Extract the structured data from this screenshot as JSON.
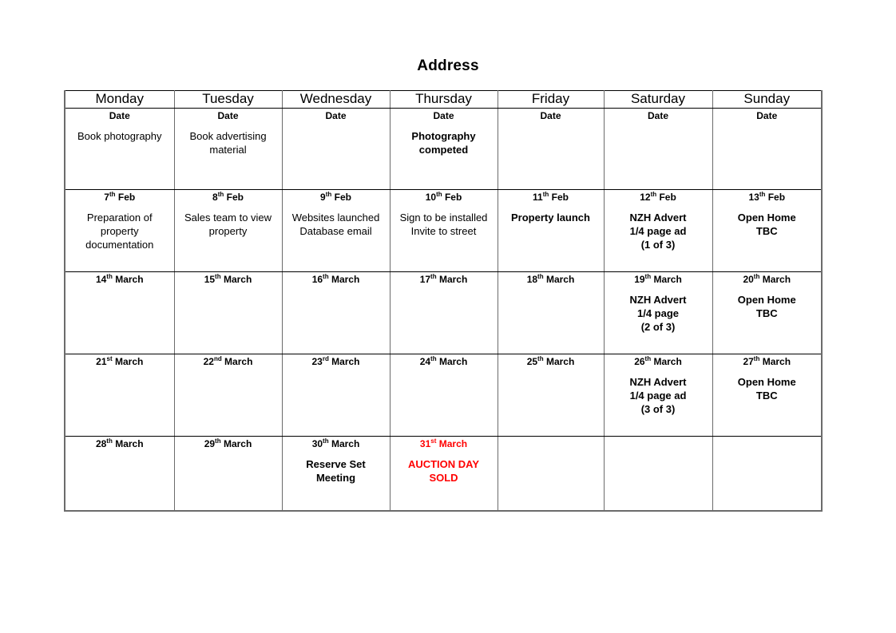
{
  "document": {
    "title": "Address"
  },
  "calendar": {
    "day_headers": [
      "Monday",
      "Tuesday",
      "Wednesday",
      "Thursday",
      "Friday",
      "Saturday",
      "Sunday"
    ],
    "header_date_label": "Date",
    "colors": {
      "text": "#000000",
      "highlight": "#ff0000",
      "border": "#6b6b6b"
    },
    "rows": [
      {
        "row_id": "week-1",
        "cells": [
          {
            "date": "Date",
            "date_ordinal": "",
            "date_suffix": "",
            "body": "Book photography",
            "bold": false,
            "red": false
          },
          {
            "date": "Date",
            "date_ordinal": "",
            "date_suffix": "",
            "body": "Book advertising\nmaterial",
            "bold": false,
            "red": false
          },
          {
            "date": "Date",
            "date_ordinal": "",
            "date_suffix": "",
            "body": "",
            "bold": false,
            "red": false
          },
          {
            "date": "Date",
            "date_ordinal": "",
            "date_suffix": "",
            "body": "Photography\ncompeted",
            "bold": true,
            "red": false
          },
          {
            "date": "Date",
            "date_ordinal": "",
            "date_suffix": "",
            "body": "",
            "bold": false,
            "red": false
          },
          {
            "date": "Date",
            "date_ordinal": "",
            "date_suffix": "",
            "body": "",
            "bold": false,
            "red": false
          },
          {
            "date": "Date",
            "date_ordinal": "",
            "date_suffix": "",
            "body": "",
            "bold": false,
            "red": false
          }
        ]
      },
      {
        "row_id": "week-2",
        "cells": [
          {
            "date_num": "7",
            "date_suffix": "th",
            "date_month": " Feb",
            "body": "Preparation of\nproperty\ndocumentation",
            "bold": false,
            "red": false
          },
          {
            "date_num": "8",
            "date_suffix": "th",
            "date_month": " Feb",
            "body": "Sales team to view\nproperty",
            "bold": false,
            "red": false
          },
          {
            "date_num": "9",
            "date_suffix": "th",
            "date_month": " Feb",
            "body": "Websites launched\nDatabase email",
            "bold": false,
            "red": false
          },
          {
            "date_num": "10",
            "date_suffix": "th",
            "date_month": " Feb",
            "body": "Sign to be installed\nInvite to street",
            "bold": false,
            "red": false
          },
          {
            "date_num": "11",
            "date_suffix": "th",
            "date_month": " Feb",
            "body": "Property launch",
            "bold": true,
            "red": false
          },
          {
            "date_num": "12",
            "date_suffix": "th",
            "date_month": " Feb",
            "body": "NZH Advert\n1/4 page ad\n(1 of 3)",
            "bold": true,
            "red": false
          },
          {
            "date_num": "13",
            "date_suffix": "th",
            "date_month": " Feb",
            "body": "Open Home\nTBC",
            "bold": true,
            "red": false
          }
        ]
      },
      {
        "row_id": "week-3",
        "cells": [
          {
            "date_num": "14",
            "date_suffix": "th",
            "date_month": " March",
            "body": "",
            "bold": false,
            "red": false
          },
          {
            "date_num": "15",
            "date_suffix": "th",
            "date_month": " March",
            "body": "",
            "bold": false,
            "red": false
          },
          {
            "date_num": "16",
            "date_suffix": "th",
            "date_month": " March",
            "body": "",
            "bold": false,
            "red": false
          },
          {
            "date_num": "17",
            "date_suffix": "th",
            "date_month": " March",
            "body": "",
            "bold": false,
            "red": false
          },
          {
            "date_num": "18",
            "date_suffix": "th",
            "date_month": " March",
            "body": "",
            "bold": false,
            "red": false
          },
          {
            "date_num": "19",
            "date_suffix": "th",
            "date_month": " March",
            "body": "NZH Advert\n1/4 page\n(2 of 3)",
            "bold": true,
            "red": false
          },
          {
            "date_num": "20",
            "date_suffix": "th",
            "date_month": " March",
            "body": "Open Home\nTBC",
            "bold": true,
            "red": false
          }
        ]
      },
      {
        "row_id": "week-4",
        "cells": [
          {
            "date_num": "21",
            "date_suffix": "st",
            "date_month": " March",
            "body": "",
            "bold": false,
            "red": false
          },
          {
            "date_num": "22",
            "date_suffix": "nd",
            "date_month": " March",
            "body": "",
            "bold": false,
            "red": false
          },
          {
            "date_num": "23",
            "date_suffix": "rd",
            "date_month": " March",
            "body": "",
            "bold": false,
            "red": false
          },
          {
            "date_num": "24",
            "date_suffix": "th",
            "date_month": " March",
            "body": "",
            "bold": false,
            "red": false
          },
          {
            "date_num": "25",
            "date_suffix": "th",
            "date_month": " March",
            "body": "",
            "bold": false,
            "red": false
          },
          {
            "date_num": "26",
            "date_suffix": "th",
            "date_month": " March",
            "body": "NZH Advert\n1/4 page ad\n(3 of 3)",
            "bold": true,
            "red": false
          },
          {
            "date_num": "27",
            "date_suffix": "th",
            "date_month": " March",
            "body": "Open Home\nTBC",
            "bold": true,
            "red": false
          }
        ]
      },
      {
        "row_id": "week-5",
        "cells": [
          {
            "date_num": "28",
            "date_suffix": "th",
            "date_month": " March",
            "body": "",
            "bold": false,
            "red": false
          },
          {
            "date_num": "29",
            "date_suffix": "th",
            "date_month": " March",
            "body": "",
            "bold": false,
            "red": false
          },
          {
            "date_num": "30",
            "date_suffix": "th",
            "date_month": " March",
            "body": "Reserve Set\nMeeting",
            "bold": true,
            "red": false
          },
          {
            "date_num": "31",
            "date_suffix": "st",
            "date_month": " March",
            "body": "AUCTION DAY\nSOLD",
            "bold": true,
            "red": true
          },
          {
            "date_num": "",
            "date_suffix": "",
            "date_month": "",
            "body": "",
            "bold": false,
            "red": false
          },
          {
            "date_num": "",
            "date_suffix": "",
            "date_month": "",
            "body": "",
            "bold": false,
            "red": false
          },
          {
            "date_num": "",
            "date_suffix": "",
            "date_month": "",
            "body": "",
            "bold": false,
            "red": false
          }
        ]
      }
    ]
  }
}
